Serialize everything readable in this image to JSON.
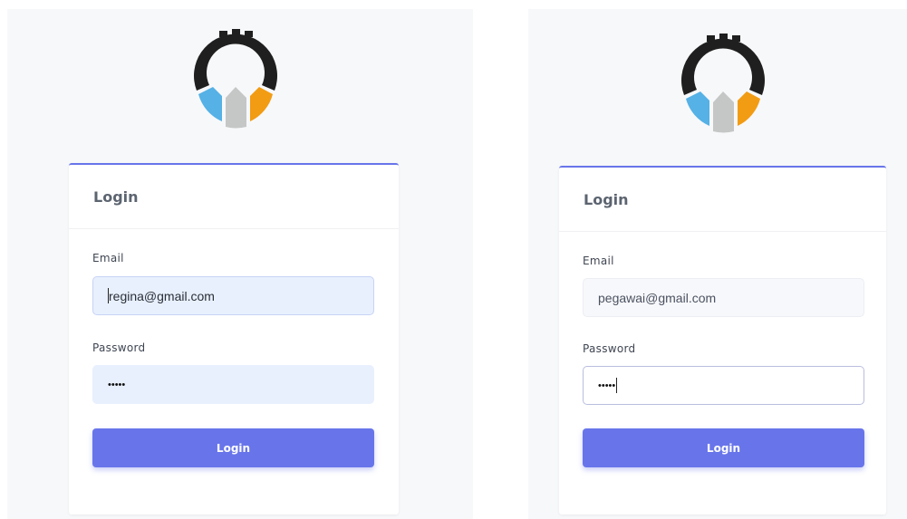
{
  "colors": {
    "accent": "#6875ea",
    "logo_dark": "#1f1f1f",
    "logo_blue": "#55b1e6",
    "logo_gray": "#c5c7c6",
    "logo_orange": "#f29c13",
    "autofill_bg": "#e8f0fe"
  },
  "screens": [
    {
      "card_title": "Login",
      "email_label": "Email",
      "email_value": "regina@gmail.com",
      "password_label": "Password",
      "password_mask": "•••••",
      "button_label": "Login"
    },
    {
      "card_title": "Login",
      "email_label": "Email",
      "email_value": "pegawai@gmail.com",
      "password_label": "Password",
      "password_mask": "•••••",
      "button_label": "Login"
    }
  ]
}
